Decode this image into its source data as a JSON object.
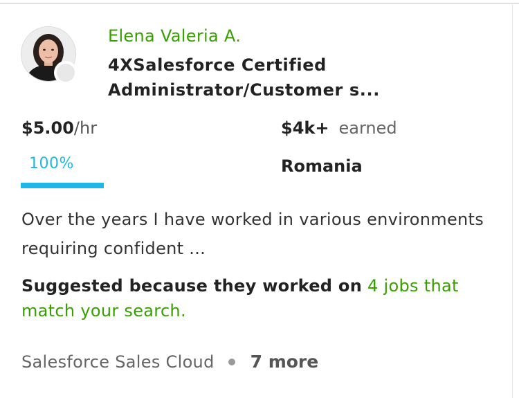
{
  "freelancer": {
    "name": "Elena Valeria A.",
    "title": "4XSalesforce Certified Administrator/Customer s...",
    "avatar_icon": "profile-photo",
    "online_status_icon": "offline-status-dot",
    "rate": {
      "amount": "$5.00",
      "unit": "/hr"
    },
    "earnings": {
      "amount": "$4k+",
      "label": "earned"
    },
    "job_success": {
      "label": "100%",
      "percent": 100
    },
    "country": "Romania",
    "overview": "Over the years I have worked in various environments requiring confident ...",
    "suggestion": {
      "prefix": "Suggested because they worked on",
      "link": "4 jobs that match your search."
    },
    "skills": {
      "first": "Salesforce Sales Cloud",
      "more": "7 more"
    }
  },
  "colors": {
    "name_link": "#37a000",
    "job_success_accent": "#1fb6e8",
    "muted_text": "#656565"
  }
}
